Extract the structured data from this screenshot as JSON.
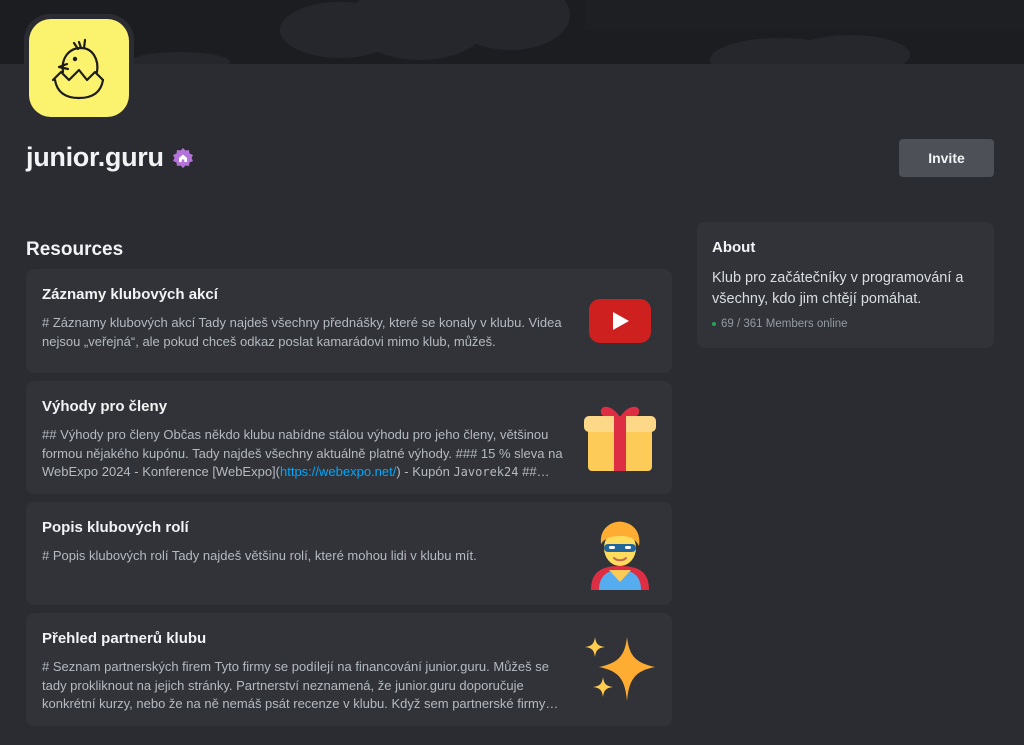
{
  "server": {
    "name": "junior.guru",
    "icon": "chick-hatching-icon",
    "badge_icon": "community-home-icon",
    "invite_label": "Invite"
  },
  "resources": {
    "title": "Resources",
    "items": [
      {
        "title": "Záznamy klubových akcí",
        "desc": "# Záznamy klubových akcí Tady najdeš všechny přednášky, které se konaly v klubu. Videa nejsou „veřejná“, ale pokud chceš odkaz poslat kamarádovi mimo klub, můžeš.",
        "thumb": "youtube-icon"
      },
      {
        "title": "Výhody pro členy",
        "desc_before": "## Výhody pro členy Občas někdo klubu nabídne stálou výhodu pro jeho členy, většinou formou nějakého kupónu. Tady najdeš všechny aktuálně platné výhody. ### 15 % sleva na WebExpo 2024 - Konference [WebExpo](",
        "desc_link": "https://webexpo.net/",
        "desc_middle": ") - Kupón ",
        "desc_code": "Javorek24",
        "desc_after": " ##…",
        "thumb": "gift-icon"
      },
      {
        "title": "Popis klubových rolí",
        "desc": "# Popis klubových rolí Tady najdeš většinu rolí, které mohou lidi v klubu mít.",
        "thumb": "superhero-icon"
      },
      {
        "title": "Přehled partnerů klubu",
        "desc": "# Seznam partnerských firem Tyto firmy se podílejí na financování junior.guru. Můžeš se tady prokliknout na jejich stránky. Partnerství neznamená, že junior.guru doporučuje konkrétní kurzy, nebo že na ně nemáš psát recenze v klubu. Když sem partnerské firmy…",
        "thumb": "sparkles-icon"
      }
    ]
  },
  "about": {
    "title": "About",
    "text": "Klub pro začátečníky v programování a všechny, kdo jim chtějí pomáhat.",
    "online": "69 / 361 Members online"
  },
  "colors": {
    "background": "#2b2c31",
    "card": "#313338",
    "accent_link": "#00a8fc",
    "online_green": "#23a55a",
    "icon_yellow": "#fbf26e",
    "badge_purple": "#b473d8"
  }
}
